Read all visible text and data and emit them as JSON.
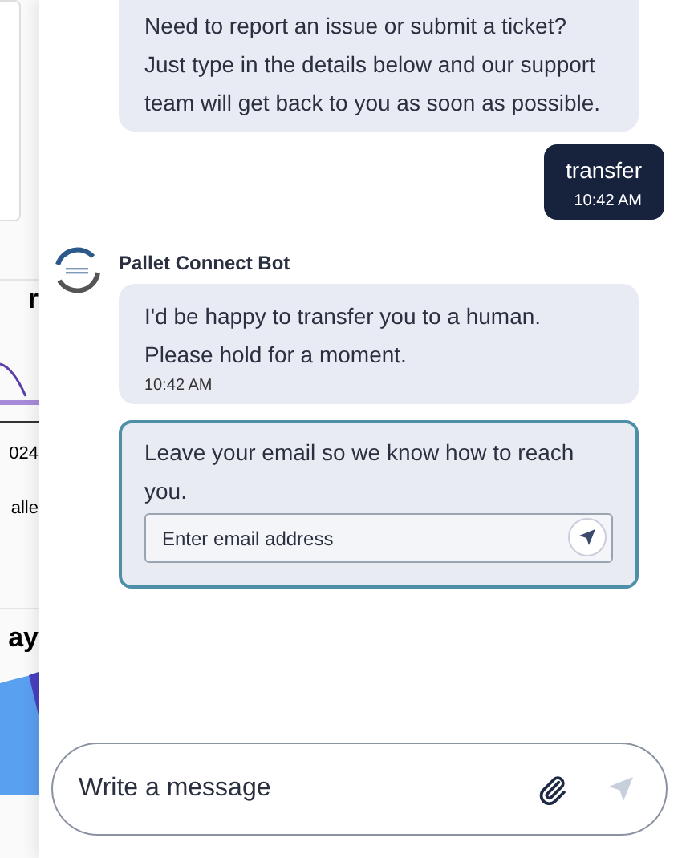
{
  "background_page": {
    "heading_1": "r",
    "date": "024",
    "label": "alle",
    "heading_2": "ay"
  },
  "messages": [
    {
      "kind": "bot_text",
      "text": "Need to report an issue or submit a ticket? Just type in the details below and our support team will get back to you as soon as possible."
    },
    {
      "kind": "user_text",
      "text": "transfer",
      "time": "10:42 AM"
    },
    {
      "kind": "bot_text",
      "sender": "Pallet Connect Bot",
      "text": "I'd be happy to transfer you to a human. Please hold for a moment.",
      "time": "10:42 AM"
    },
    {
      "kind": "email_form",
      "text": "Leave your email so we know how to reach you.",
      "placeholder": "Enter email address"
    }
  ],
  "composer": {
    "placeholder": "Write a message"
  }
}
